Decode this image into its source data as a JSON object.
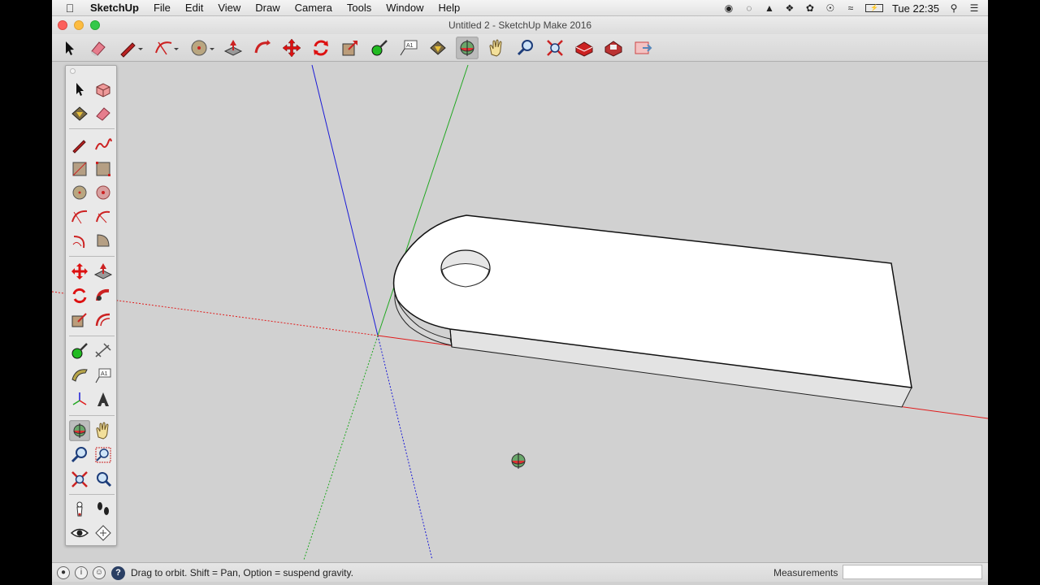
{
  "menubar": {
    "apple": "",
    "app_name": "SketchUp",
    "items": [
      "File",
      "Edit",
      "View",
      "Draw",
      "Camera",
      "Tools",
      "Window",
      "Help"
    ],
    "clock": "Tue 22:35",
    "status_icons": [
      "record-icon",
      "grammarly-icon",
      "drive-icon",
      "dropbox-icon",
      "evernote-icon",
      "podcast-icon",
      "wifi-icon",
      "battery-icon",
      "search-icon",
      "list-icon"
    ]
  },
  "window": {
    "title": "Untitled 2 - SketchUp Make 2016"
  },
  "toolbar": {
    "tools": [
      "select",
      "eraser",
      "line",
      "arc",
      "circle",
      "push-pull",
      "follow-me",
      "move",
      "rotate",
      "scale",
      "tape-measure",
      "text",
      "paint-bucket",
      "orbit",
      "pan",
      "zoom",
      "zoom-extents",
      "3d-warehouse",
      "extension-warehouse",
      "layout"
    ],
    "active_tool": "orbit"
  },
  "palette": {
    "active_tool": "orbit"
  },
  "status": {
    "hint": "Drag to orbit. Shift = Pan, Option = suspend gravity.",
    "help_glyph": "?",
    "measurements_label": "Measurements",
    "measurements_value": ""
  },
  "colors": {
    "axis_red": "#e01b1b",
    "axis_green": "#21a821",
    "axis_blue": "#1b1bd6",
    "viewport_bg": "#d1d1d1",
    "face_white": "#ffffff",
    "face_shade": "#e3e3e3"
  }
}
